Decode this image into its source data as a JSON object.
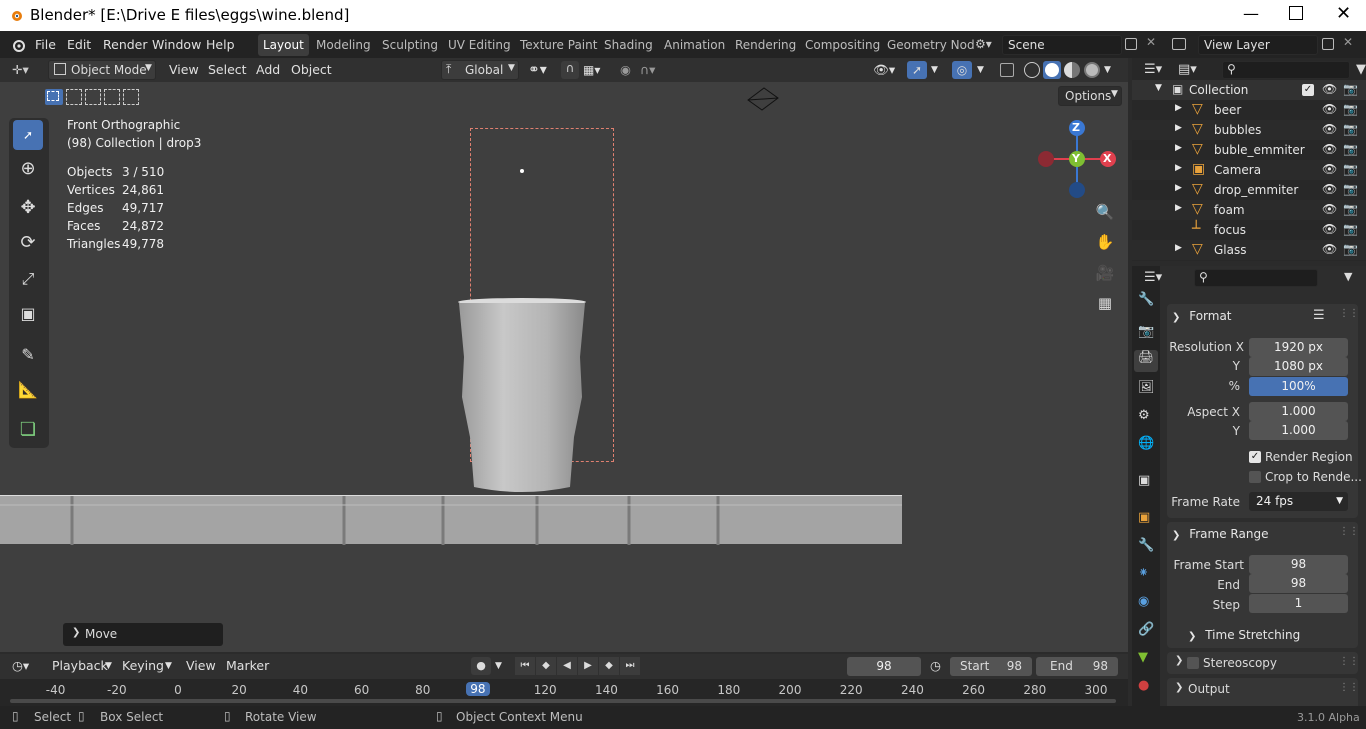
{
  "window": {
    "title": "Blender* [E:\\Drive E files\\eggs\\wine.blend]",
    "minimize_icon": "minimize-icon",
    "maximize_icon": "maximize-icon",
    "close_icon": "close-icon"
  },
  "menubar": {
    "menus": [
      "File",
      "Edit",
      "Render",
      "Window",
      "Help"
    ],
    "workspaces": [
      "Layout",
      "Modeling",
      "Sculpting",
      "UV Editing",
      "Texture Paint",
      "Shading",
      "Animation",
      "Rendering",
      "Compositing",
      "Geometry Nod"
    ],
    "active_workspace": "Layout",
    "scene": "Scene",
    "view_layer": "View Layer"
  },
  "viewport_header": {
    "mode": "Object Mode",
    "menus": [
      "View",
      "Select",
      "Add",
      "Object"
    ],
    "orientation": "Global",
    "options_label": "Options"
  },
  "viewport": {
    "view_name": "Front Orthographic",
    "collection_info": "(98) Collection | drop3",
    "stats": [
      {
        "label": "Objects",
        "value": "3 / 510"
      },
      {
        "label": "Vertices",
        "value": "24,861"
      },
      {
        "label": "Edges",
        "value": "49,717"
      },
      {
        "label": "Faces",
        "value": "24,872"
      },
      {
        "label": "Triangles",
        "value": "49,778"
      }
    ],
    "gizmo": {
      "z": "Z",
      "y": "Y",
      "x": "X"
    },
    "last_operator": "Move"
  },
  "outliner": {
    "root": "Collection",
    "items": [
      {
        "name": "beer",
        "icon": "mesh-icon"
      },
      {
        "name": "bubbles",
        "icon": "mesh-icon"
      },
      {
        "name": "buble_emmiter",
        "icon": "mesh-icon"
      },
      {
        "name": "Camera",
        "icon": "camera-icon"
      },
      {
        "name": "drop_emmiter",
        "icon": "mesh-icon"
      },
      {
        "name": "foam",
        "icon": "mesh-icon"
      },
      {
        "name": "focus",
        "icon": "empty-icon"
      },
      {
        "name": "Glass",
        "icon": "mesh-icon"
      }
    ]
  },
  "properties": {
    "format": {
      "title": "Format",
      "resolution_x_label": "Resolution X",
      "resolution_x": "1920 px",
      "y_label": "Y",
      "resolution_y": "1080 px",
      "percent_label": "%",
      "percent": "100%",
      "aspect_x_label": "Aspect X",
      "aspect_x": "1.000",
      "aspect_y_label": "Y",
      "aspect_y": "1.000",
      "render_region": "Render Region",
      "crop": "Crop to Rende...",
      "frame_rate_label": "Frame Rate",
      "frame_rate": "24 fps"
    },
    "frame_range": {
      "title": "Frame Range",
      "start_label": "Frame Start",
      "start": "98",
      "end_label": "End",
      "end": "98",
      "step_label": "Step",
      "step": "1"
    },
    "time_stretching": "Time Stretching",
    "stereoscopy": "Stereoscopy",
    "output": "Output"
  },
  "timeline": {
    "menus": [
      "Playback",
      "Keying",
      "View",
      "Marker"
    ],
    "current_frame": "98",
    "start_label": "Start",
    "start": "98",
    "end_label": "End",
    "end": "98",
    "ticks": [
      "-40",
      "-20",
      "0",
      "20",
      "40",
      "60",
      "80",
      "98",
      "120",
      "140",
      "160",
      "180",
      "200",
      "220",
      "240",
      "260",
      "280",
      "300"
    ]
  },
  "statusbar": {
    "select": "Select",
    "box_select": "Box Select",
    "rotate_view": "Rotate View",
    "context_menu": "Object Context Menu",
    "version": "3.1.0 Alpha"
  },
  "colors": {
    "accent_blue": "#4772b3",
    "active_frame": "#4772b3",
    "axis_x": "#e0404e",
    "axis_y": "#7fbf32",
    "axis_z": "#3a78d4",
    "mesh_icon": "#e9a23b"
  }
}
